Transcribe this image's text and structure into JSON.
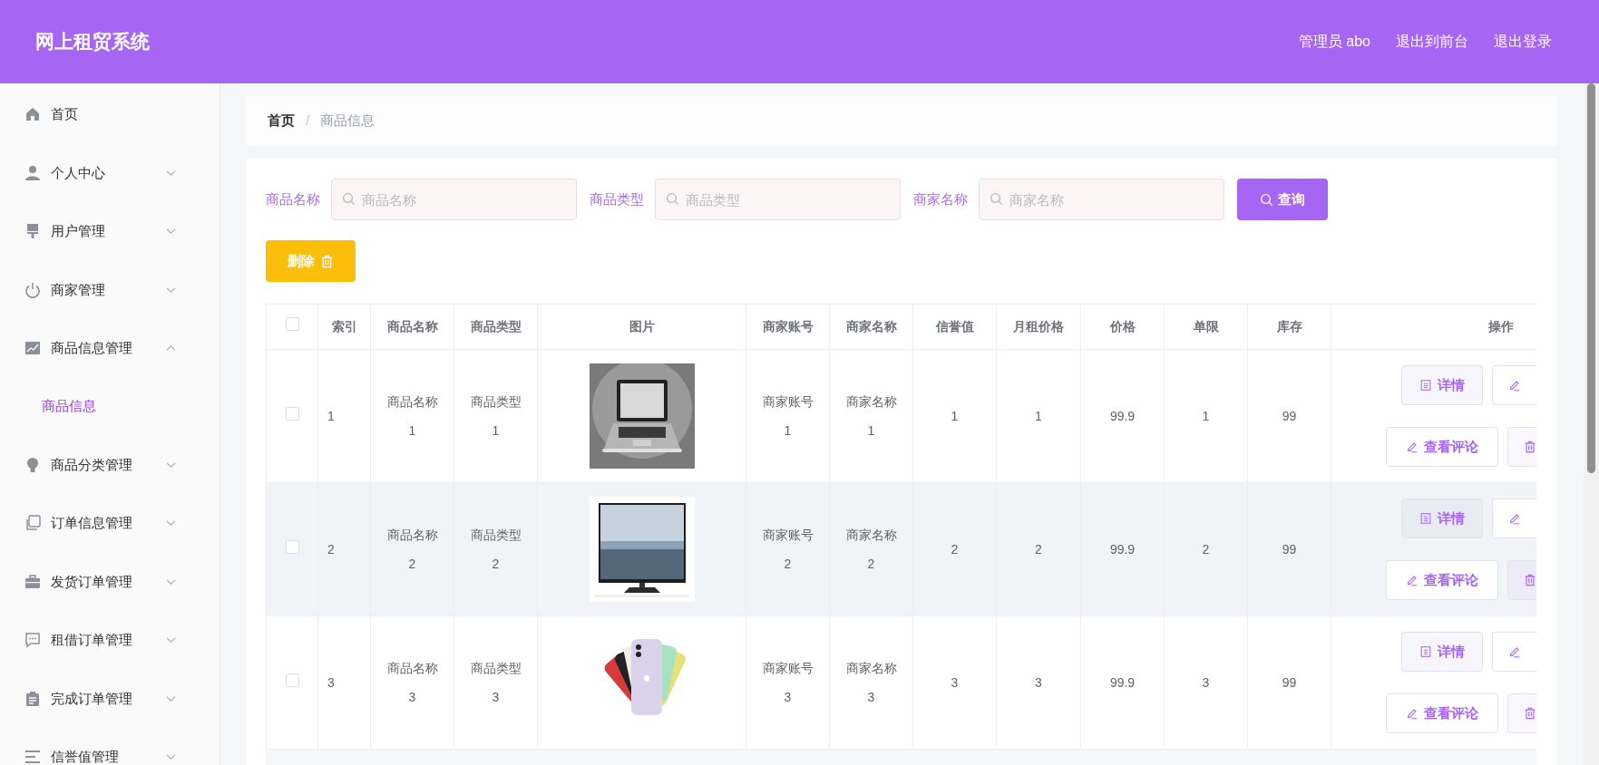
{
  "header": {
    "title": "网上租贸系统",
    "links": [
      "管理员 abo",
      "退出到前台",
      "退出登录"
    ]
  },
  "sidebar": {
    "items": [
      {
        "label": "首页"
      },
      {
        "label": "个人中心",
        "expanded": false
      },
      {
        "label": "用户管理",
        "expanded": false
      },
      {
        "label": "商家管理",
        "expanded": false
      },
      {
        "label": "商品信息管理",
        "expanded": true,
        "children": [
          {
            "label": "商品信息",
            "selected": true
          }
        ]
      },
      {
        "label": "商品分类管理",
        "expanded": false
      },
      {
        "label": "订单信息管理",
        "expanded": false
      },
      {
        "label": "发货订单管理",
        "expanded": false
      },
      {
        "label": "租借订单管理",
        "expanded": false
      },
      {
        "label": "完成订单管理",
        "expanded": false
      },
      {
        "label": "信誉值管理",
        "expanded": false
      }
    ]
  },
  "breadcrumb": [
    "首页",
    "商品信息"
  ],
  "breadcrumb_separator": "/",
  "search": {
    "fields": [
      {
        "label": "商品名称",
        "placeholder": "商品名称"
      },
      {
        "label": "商品类型",
        "placeholder": "商品类型"
      },
      {
        "label": "商家名称",
        "placeholder": "商家名称"
      }
    ],
    "button": "查询"
  },
  "delete_button": "删除",
  "table": {
    "select_all_checked": false,
    "columns": [
      "索引",
      "商品名称",
      "商品类型",
      "图片",
      "商家账号",
      "商家名称",
      "信誉值",
      "月租价格",
      "价格",
      "单限",
      "库存",
      "操作"
    ],
    "rows": [
      {
        "checked": false,
        "hovered": false,
        "cells": [
          "1",
          "商品名称1",
          "商品类型1",
          "",
          "商家账号1",
          "商家名称1",
          "1",
          "1",
          "99.9",
          "1",
          "99"
        ],
        "picture": {
          "kind": "picture"
        },
        "actions": [
          "详情",
          "查看评论"
        ]
      },
      {
        "checked": false,
        "hovered": true,
        "cells": [
          "2",
          "商品名称2",
          "商品类型2",
          "",
          "商家账号2",
          "商家名称2",
          "2",
          "2",
          "99.9",
          "2",
          "99"
        ],
        "picture": {
          "kind": "picture"
        },
        "actions": [
          "详情",
          "查看评论"
        ]
      },
      {
        "checked": false,
        "hovered": false,
        "cells": [
          "3",
          "商品名称3",
          "商品类型3",
          "",
          "商家账号3",
          "商家名称3",
          "3",
          "3",
          "99.9",
          "3",
          "99"
        ],
        "picture": {
          "kind": "picture"
        },
        "actions": [
          "详情",
          "查看评论"
        ]
      }
    ]
  }
}
